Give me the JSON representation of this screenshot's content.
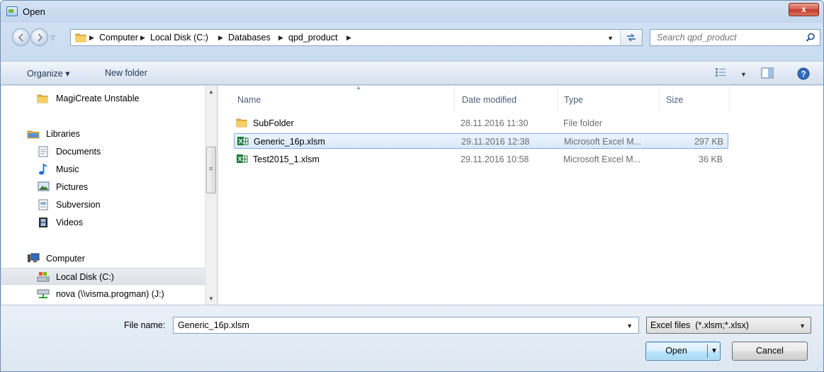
{
  "window": {
    "title": "Open",
    "close_label": "x"
  },
  "address": {
    "crumbs": [
      "Computer",
      "Local Disk (C:)",
      "Databases",
      "qpd_product"
    ]
  },
  "search": {
    "placeholder": "Search qpd_product"
  },
  "toolbar": {
    "organize_label": "Organize ▾",
    "new_folder_label": "New folder"
  },
  "nav": {
    "items": [
      {
        "label": "MagiCreate Unstable",
        "icon": "folder-icon"
      },
      {
        "label": "Libraries",
        "icon": "libraries-icon"
      },
      {
        "label": "Documents",
        "icon": "documents-icon"
      },
      {
        "label": "Music",
        "icon": "music-icon"
      },
      {
        "label": "Pictures",
        "icon": "pictures-icon"
      },
      {
        "label": "Subversion",
        "icon": "subversion-icon"
      },
      {
        "label": "Videos",
        "icon": "videos-icon"
      },
      {
        "label": "Computer",
        "icon": "computer-icon"
      },
      {
        "label": "Local Disk (C:)",
        "icon": "local-disk-icon",
        "selected": true
      },
      {
        "label": "nova (\\\\visma.progman) (J:)",
        "icon": "network-drive-icon"
      }
    ]
  },
  "files": {
    "columns": [
      "Name",
      "Date modified",
      "Type",
      "Size"
    ],
    "rows": [
      {
        "name": "SubFolder",
        "date": "28.11.2016 11:30",
        "type": "File folder",
        "size": "",
        "icon": "folder-icon"
      },
      {
        "name": "Generic_16p.xlsm",
        "date": "29.11.2016 12:38",
        "type": "Microsoft Excel M...",
        "size": "297 KB",
        "icon": "excel-file-icon",
        "selected": true
      },
      {
        "name": "Test2015_1.xlsm",
        "date": "29.11.2016 10:58",
        "type": "Microsoft Excel M...",
        "size": "36 KB",
        "icon": "excel-file-icon"
      }
    ]
  },
  "bottom": {
    "file_name_label": "File name:",
    "file_name_value": "Generic_16p.xlsm",
    "file_type_value": "Excel files  (*.xlsm;*.xlsx)",
    "open_label": "Open",
    "cancel_label": "Cancel"
  },
  "colors": {
    "selection_border": "#84acdd",
    "chrome": "#c9d9ec",
    "close_red": "#c13a2b"
  }
}
